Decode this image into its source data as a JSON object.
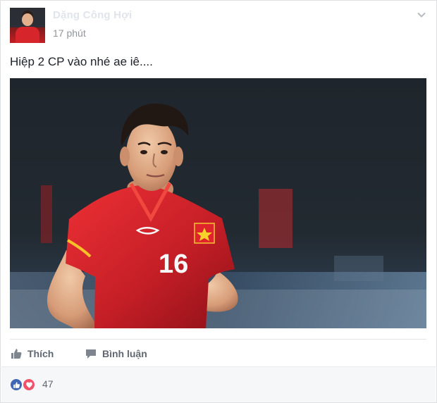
{
  "post": {
    "author_name": "Dặng Công Hợi",
    "timestamp": "17 phút",
    "message": "Hiệp 2 CP vào nhé ae iê....",
    "photo": {
      "jersey_number": "16"
    }
  },
  "actions": {
    "like_label": "Thích",
    "comment_label": "Bình luận"
  },
  "reactions": {
    "count": "47"
  },
  "colors": {
    "facebook_blue": "#4267b2",
    "love_red": "#f25268",
    "secondary_text": "#90949c",
    "action_text": "#616770",
    "jersey_red": "#d7262b"
  },
  "icons": {
    "post_menu": "chevron-down-icon",
    "like_action": "thumbs-up-icon",
    "comment_action": "speech-bubble-icon",
    "like_reaction": "like-reaction-icon",
    "love_reaction": "love-reaction-icon"
  }
}
